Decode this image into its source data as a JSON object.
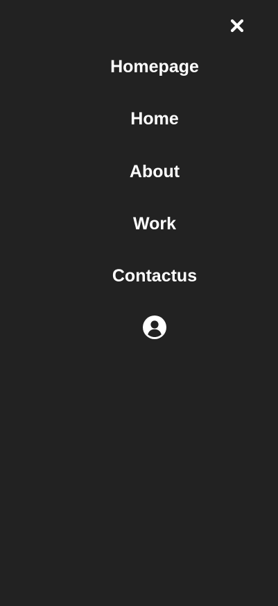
{
  "menu": {
    "close_icon": "close-icon",
    "items": [
      {
        "label": "Homepage"
      },
      {
        "label": "Home"
      },
      {
        "label": "About"
      },
      {
        "label": "Work"
      },
      {
        "label": "Contactus"
      }
    ],
    "account_icon": "user-circle-icon"
  },
  "colors": {
    "background": "#222222",
    "foreground": "#ffffff"
  }
}
